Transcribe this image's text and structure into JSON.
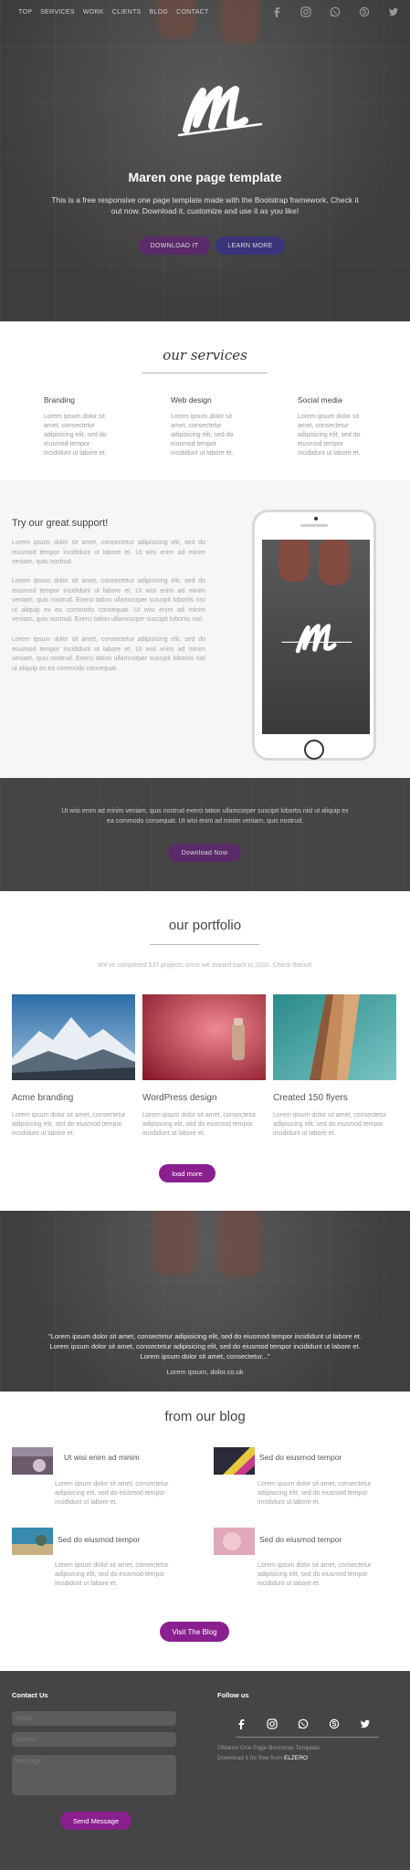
{
  "nav": {
    "links": [
      "TOP",
      "SERVICES",
      "WORK",
      "CLIENTS",
      "BLOG",
      "CONTACT"
    ],
    "social_icons": [
      "facebook-icon",
      "instagram-icon",
      "whatsapp-icon",
      "skype-icon",
      "twitter-icon"
    ]
  },
  "hero": {
    "title": "Maren one page template",
    "subtitle": "This is a free responsive one page template made with the Bootstrap framework. Check it out now. Download it, customize and use it as you like!",
    "download_label": "DOWNLOAD IT",
    "learn_label": "LEARN MORE"
  },
  "services": {
    "title": "our services",
    "items": [
      {
        "title": "Branding",
        "text": "Lorem ipsum dolor sit amet, consectetur adipisicing elit, sed do eiusmod tempor incididunt ut labore et."
      },
      {
        "title": "Web design",
        "text": "Lorem ipsum dolor sit amet, consectetur adipisicing elit, sed do eiusmod tempor incididunt ut labore et."
      },
      {
        "title": "Social media",
        "text": "Lorem ipsum dolor sit amet, consectetur adipisicing elit, sed do eiusmod tempor incididunt ut labore et."
      }
    ]
  },
  "support": {
    "title": "Try our great support!",
    "paragraphs": [
      "Lorem ipsum dolor sit amet, consectetur adipisicing elit, sed do eiusmod tempor incididunt ut labore et. Ut wisi enim ad minim veniam, quis nostrud.",
      "Lorem ipsum dolor sit amet, consectetur adipisicing elit, sed do eiusmod tempor incididunt ut labore et. Ut wisi enim ad minim veniam, quis nostrud. Exerci tation ullamcorper suscipit lobortis nisl ut aliquip ex ea commodo consequat. Ut wisi enim ad minim veniam, quis nostrud. Exerci tation ullamcorper suscipit lobortis nisl.",
      "Lorem ipsum dolor sit amet, consectetur adipisicing elit, sed do eiusmod tempor incididunt ut labore et. Ut wisi enim ad minim veniam, quis nostrud. Exerci tation ullamcorper suscipit lobortis nisl ut aliquip ex ea commodo consequat."
    ]
  },
  "band": {
    "text": "Ut wisi enim ad minim veniam, quis nostrud exerci tation ullamcorper suscipit lobortis nisl ut aliquip ex ea commodo consequat. Ut wisi enim ad minim veniam, quis nostrud.",
    "button_label": "Download Now"
  },
  "portfolio": {
    "title": "our portfolio",
    "subtitle": "We've completed 537 projects since we started back in 2010. Check theout!",
    "items": [
      {
        "title": "Acme branding",
        "text": "Lorem ipsum dolor sit amet, consectetur adipisicing elit, sed do eiusmod tempor incididunt ut labore et."
      },
      {
        "title": "WordPress design",
        "text": "Lorem ipsum dolor sit amet, consectetur adipisicing elit, sed do eiusmod tempor incididunt ut labore et."
      },
      {
        "title": "Created 150 flyers",
        "text": "Lorem ipsum dolor sit amet, consectetur adipisicing elit, sed do eiusmod tempor incididunt ut labore et."
      }
    ],
    "load_label": "load more"
  },
  "testimonial": {
    "quote": "\"Lorem ipsum dolor sit amet, consectetur adipisicing elit, sed do eiusmod tempor incididunt ut labore et. Lorem ipsum dolor sit amet, consectetur adipisicing elit, sed do eiusmod tempor incididunt ut labore et. Lorem ipsum dolor sit amet, consectetur...\"",
    "author": "Lorem Ipsum, dolor.co.uk"
  },
  "blog": {
    "title": "from our blog",
    "posts": [
      {
        "title": "Ut wisi enim ad minim",
        "text": "Lorem ipsum dolor sit amet, consectetur adipisicing elit, sed do eiusmod tempor incididunt ut labore et."
      },
      {
        "title": "Sed do eiusmod tempor",
        "text": "Lorem ipsum dolor sit amet, consectetur adipisicing elit, sed do eiusmod tempor incididunt ut labore et."
      },
      {
        "title": "Sed do eiusmod tempor",
        "text": "Lorem ipsum dolor sit amet, consectetur adipisicing elit, sed do eiusmod tempor incididunt ut labore et."
      },
      {
        "title": "Sed do eiusmod tempor",
        "text": "Lorem ipsum dolor sit amet, consectetur adipisicing elit, sed do eiusmod tempor incididunt ut labore et."
      }
    ],
    "button_label": "Visit The Blog"
  },
  "footer": {
    "contact_title": "Contact Us",
    "email_placeholder": "Email",
    "subject_placeholder": "Subject",
    "message_placeholder": "Message",
    "send_label": "Send Message",
    "follow_title": "Follow us",
    "copyright": "©Maren One Page Bootstrap Template",
    "download_prefix": "Download it for free from",
    "brand": "ELZERO"
  },
  "colors": {
    "accent_purple": "#8a1f8f",
    "dark_band": "#454545"
  }
}
